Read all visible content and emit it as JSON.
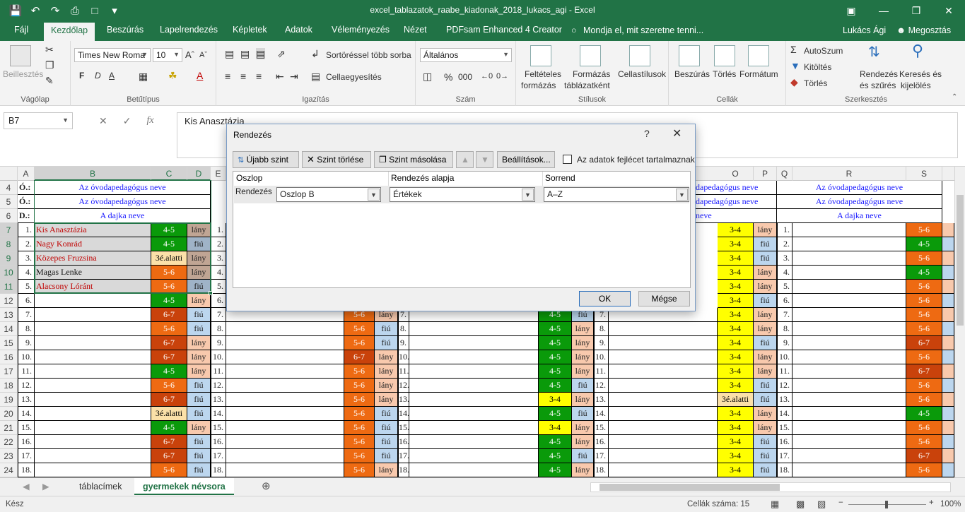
{
  "window": {
    "title": "excel_tablazatok_raabe_kiadonak_2018_lukacs_agi - Excel"
  },
  "ribbon_tabs": [
    "Fájl",
    "Kezdőlap",
    "Beszúrás",
    "Lapelrendezés",
    "Képletek",
    "Adatok",
    "Véleményezés",
    "Nézet",
    "PDFsam Enhanced 4 Creator"
  ],
  "tell_me": "Mondja el, mit szeretne tenni...",
  "user": "Lukács Ági",
  "share": "Megosztás",
  "ribbon": {
    "clipboard": {
      "paste": "Beillesztés",
      "label": "Vágólap"
    },
    "font": {
      "name": "Times New Roma",
      "size": "10",
      "label": "Betűtípus",
      "bold": "F",
      "italic": "D",
      "underline": "A"
    },
    "alignment": {
      "wrap": "Sortöréssel több sorba",
      "merge": "Cellaegyesítés",
      "label": "Igazítás"
    },
    "number": {
      "format": "Általános",
      "percent": "%",
      "thousands": "000",
      "label": "Szám"
    },
    "styles": {
      "conditional": "Feltételes",
      "conditional2": "formázás",
      "table": "Formázás",
      "table2": "táblázatként",
      "cellstyles": "Cellastílusok",
      "label": "Stílusok"
    },
    "cells": {
      "insert": "Beszúrás",
      "delete": "Törlés",
      "format": "Formátum",
      "label": "Cellák"
    },
    "editing": {
      "autosum": "AutoSzum",
      "fill": "Kitöltés",
      "clear": "Törlés",
      "sort": "Rendezés",
      "sort2": "és szűrés",
      "find": "Keresés és",
      "find2": "kijelölés",
      "label": "Szerkesztés"
    }
  },
  "formula_bar": {
    "namebox": "B7",
    "fx": "fx",
    "value": "Kis Anasztázia"
  },
  "columns": [
    "A",
    "B",
    "C",
    "D",
    "E",
    "O",
    "P",
    "Q",
    "R",
    "S"
  ],
  "rows": [
    "4",
    "5",
    "6",
    "7",
    "8",
    "9",
    "10",
    "11",
    "12",
    "13",
    "14",
    "15",
    "16",
    "17",
    "18",
    "19",
    "20",
    "21",
    "22",
    "23",
    "24"
  ],
  "sheet": {
    "labels": {
      "r4": "Ó.:",
      "r5": "Ó.:",
      "r6": "D.:"
    },
    "headers": {
      "teacher": "Az óvodapedagógus neve",
      "teacher_partial": "dapedagógus neve",
      "nanny": "A dajka neve",
      "nanny_partial": "neve",
      "teacher_partial2": "dapedagógus neve"
    },
    "left_rows": [
      {
        "n": "1.",
        "name": "Kis Anasztázia",
        "grp": "4-5",
        "gen": "lány",
        "red": true
      },
      {
        "n": "2.",
        "name": "Nagy Konrád",
        "grp": "4-5",
        "gen": "fiú",
        "red": true
      },
      {
        "n": "3.",
        "name": "Közepes Fruzsina",
        "grp": "3é.alatti",
        "gen": "lány",
        "red": true
      },
      {
        "n": "4.",
        "name": "Magas Lenke",
        "grp": "5-6",
        "gen": "lány",
        "red": false
      },
      {
        "n": "5.",
        "name": "Alacsony Lóránt",
        "grp": "5-6",
        "gen": "fiú",
        "red": true
      },
      {
        "n": "6.",
        "name": "",
        "grp": "4-5",
        "gen": "lány"
      },
      {
        "n": "7.",
        "name": "",
        "grp": "6-7",
        "gen": "fiú"
      },
      {
        "n": "8.",
        "name": "",
        "grp": "5-6",
        "gen": "fiú"
      },
      {
        "n": "9.",
        "name": "",
        "grp": "6-7",
        "gen": "lány"
      },
      {
        "n": "10.",
        "name": "",
        "grp": "6-7",
        "gen": "lány"
      },
      {
        "n": "11.",
        "name": "",
        "grp": "4-5",
        "gen": "lány"
      },
      {
        "n": "12.",
        "name": "",
        "grp": "5-6",
        "gen": "fiú"
      },
      {
        "n": "13.",
        "name": "",
        "grp": "6-7",
        "gen": "fiú"
      },
      {
        "n": "14.",
        "name": "",
        "grp": "3é.alatti",
        "gen": "fiú"
      },
      {
        "n": "15.",
        "name": "",
        "grp": "4-5",
        "gen": "lány"
      },
      {
        "n": "16.",
        "name": "",
        "grp": "6-7",
        "gen": "fiú"
      },
      {
        "n": "17.",
        "name": "",
        "grp": "6-7",
        "gen": "fiú"
      },
      {
        "n": "18.",
        "name": "",
        "grp": "5-6",
        "gen": "fiú"
      }
    ],
    "e_nums": [
      "1.",
      "2.",
      "3.",
      "4.",
      "5.",
      "6.",
      "7.",
      "8.",
      "9.",
      "10.",
      "11.",
      "12.",
      "13.",
      "14.",
      "15.",
      "16.",
      "17.",
      "18."
    ],
    "mid_rows": [
      {
        "grp": "5-6",
        "gen": "lány",
        "n": "7."
      },
      {
        "grp": "5-6",
        "gen": "fiú",
        "n": "8."
      },
      {
        "grp": "5-6",
        "gen": "fiú",
        "n": "9."
      },
      {
        "grp": "6-7",
        "gen": "lány",
        "n": "10."
      },
      {
        "grp": "5-6",
        "gen": "lány",
        "n": "11."
      },
      {
        "grp": "5-6",
        "gen": "lány",
        "n": "12."
      },
      {
        "grp": "5-6",
        "gen": "lány",
        "n": "13."
      },
      {
        "grp": "5-6",
        "gen": "fiú",
        "n": "14."
      },
      {
        "grp": "5-6",
        "gen": "fiú",
        "n": "15."
      },
      {
        "grp": "5-6",
        "gen": "fiú",
        "n": "16."
      },
      {
        "grp": "5-6",
        "gen": "fiú",
        "n": "17."
      },
      {
        "grp": "5-6",
        "gen": "lány",
        "n": "18."
      }
    ],
    "mid2_rows": [
      {
        "grp": "4-5",
        "gen": "fiú",
        "n": "7."
      },
      {
        "grp": "4-5",
        "gen": "lány",
        "n": "8."
      },
      {
        "grp": "4-5",
        "gen": "lány",
        "n": "9."
      },
      {
        "grp": "4-5",
        "gen": "lány",
        "n": "10."
      },
      {
        "grp": "4-5",
        "gen": "lány",
        "n": "11."
      },
      {
        "grp": "4-5",
        "gen": "fiú",
        "n": "12."
      },
      {
        "grp": "3-4",
        "gen": "lány",
        "n": "13."
      },
      {
        "grp": "4-5",
        "gen": "fiú",
        "n": "14."
      },
      {
        "grp": "3-4",
        "gen": "lány",
        "n": "15."
      },
      {
        "grp": "4-5",
        "gen": "lány",
        "n": "16."
      },
      {
        "grp": "4-5",
        "gen": "fiú",
        "n": "17."
      },
      {
        "grp": "4-5",
        "gen": "lány",
        "n": "18."
      }
    ],
    "o_rows": [
      {
        "grp": "3-4",
        "gen": "lány",
        "n": "1."
      },
      {
        "grp": "3-4",
        "gen": "fiú",
        "n": "2."
      },
      {
        "grp": "3-4",
        "gen": "fiú",
        "n": "3."
      },
      {
        "grp": "3-4",
        "gen": "lány",
        "n": "4."
      },
      {
        "grp": "3-4",
        "gen": "lány",
        "n": "5."
      },
      {
        "grp": "3-4",
        "gen": "fiú",
        "n": "6."
      },
      {
        "grp": "3-4",
        "gen": "lány",
        "n": "7."
      },
      {
        "grp": "3-4",
        "gen": "lány",
        "n": "8."
      },
      {
        "grp": "3-4",
        "gen": "fiú",
        "n": "9."
      },
      {
        "grp": "3-4",
        "gen": "lány",
        "n": "10."
      },
      {
        "grp": "3-4",
        "gen": "lány",
        "n": "11."
      },
      {
        "grp": "3-4",
        "gen": "fiú",
        "n": "12."
      },
      {
        "grp": "3é.alatti",
        "gen": "fiú",
        "n": "13."
      },
      {
        "grp": "3-4",
        "gen": "lány",
        "n": "14."
      },
      {
        "grp": "3-4",
        "gen": "lány",
        "n": "15."
      },
      {
        "grp": "3-4",
        "gen": "fiú",
        "n": "16."
      },
      {
        "grp": "3-4",
        "gen": "fiú",
        "n": "17."
      },
      {
        "grp": "3-4",
        "gen": "fiú",
        "n": "18."
      }
    ],
    "s_rows": [
      "5-6",
      "4-5",
      "5-6",
      "4-5",
      "5-6",
      "5-6",
      "5-6",
      "5-6",
      "6-7",
      "5-6",
      "6-7",
      "5-6",
      "5-6",
      "4-5",
      "5-6",
      "5-6",
      "6-7",
      "5-6"
    ]
  },
  "colors": {
    "g45": "#0a9a0a",
    "g56": "#ee6a12",
    "g67": "#c9420b",
    "g3a": "#fbe0a8",
    "g34": "#ffff00",
    "girl": "#f8c9ad",
    "boy": "#bcd6ee",
    "accent": "#217346"
  },
  "dialog": {
    "title": "Rendezés",
    "help": "?",
    "close": "✕",
    "add": "Újabb szint",
    "delete": "Szint törlése",
    "copy": "Szint másolása",
    "options": "Beállítások...",
    "header_checkbox": "Az adatok fejlécet tartalmaznak",
    "col_header": "Oszlop",
    "sorton_header": "Rendezés alapja",
    "order_header": "Sorrend",
    "row_label": "Rendezés",
    "column_value": "Oszlop B",
    "sorton_value": "Értékek",
    "order_value": "A–Z",
    "ok": "OK",
    "cancel": "Mégse"
  },
  "sheet_tabs": [
    "táblacímek",
    "gyermekek névsora"
  ],
  "status": {
    "ready": "Kész",
    "count": "Cellák száma: 15",
    "zoom": "100%"
  }
}
